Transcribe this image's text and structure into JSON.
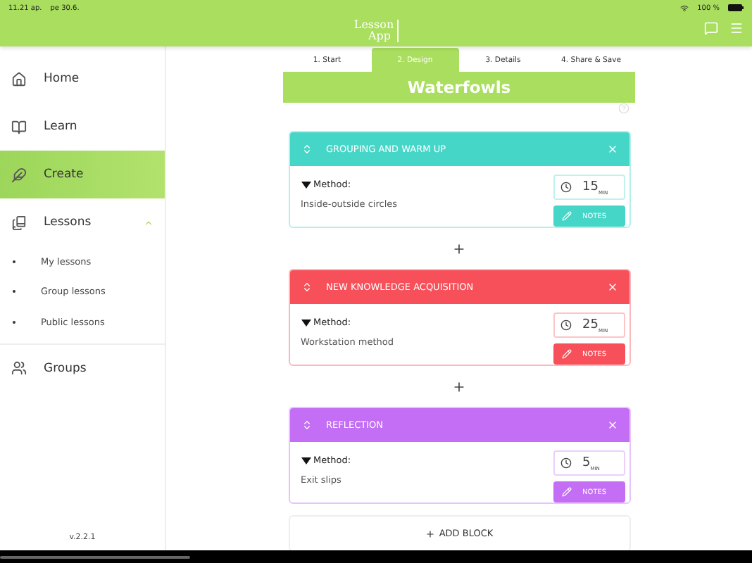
{
  "status_bar": {
    "time": "11.21 ap.",
    "date": "pe 30.6.",
    "battery": "100 %"
  },
  "logo": [
    "Lesson",
    "App"
  ],
  "sidebar": {
    "items": [
      {
        "kind": "home",
        "label": "Home",
        "selected": false
      },
      {
        "kind": "learn",
        "label": "Learn",
        "selected": false
      },
      {
        "kind": "create",
        "label": "Create",
        "selected": true
      },
      {
        "kind": "lessons",
        "label": "Lessons",
        "selected": false,
        "expanded": true,
        "children": [
          {
            "label": "My lessons"
          },
          {
            "label": "Group lessons"
          },
          {
            "label": "Public lessons"
          }
        ]
      },
      {
        "kind": "groups",
        "label": "Groups",
        "selected": false
      }
    ],
    "version": "v.2.2.1"
  },
  "tabs": [
    {
      "label": "1. Start",
      "selected": false
    },
    {
      "label": "2. Design",
      "selected": true
    },
    {
      "label": "3. Details",
      "selected": false
    },
    {
      "label": "4. Share & Save",
      "selected": false
    }
  ],
  "lesson_title": "Waterfowls",
  "blocks": [
    {
      "title": "GROUPING AND WARM UP",
      "color": "#46d6c8",
      "method_label": "Method:",
      "method": "Inside-outside circles",
      "minutes": "15",
      "unit": "MIN",
      "notes": "NOTES"
    },
    {
      "title": "NEW KNOWLEDGE ACQUISITION",
      "color": "#f7505a",
      "method_label": "Method:",
      "method": "Workstation method",
      "minutes": "25",
      "unit": "MIN",
      "notes": "NOTES"
    },
    {
      "title": "REFLECTION",
      "color": "#c36ef5",
      "method_label": "Method:",
      "method": "Exit slips",
      "minutes": "5",
      "unit": "MIN",
      "notes": "NOTES"
    }
  ],
  "add_block": "ADD BLOCK"
}
